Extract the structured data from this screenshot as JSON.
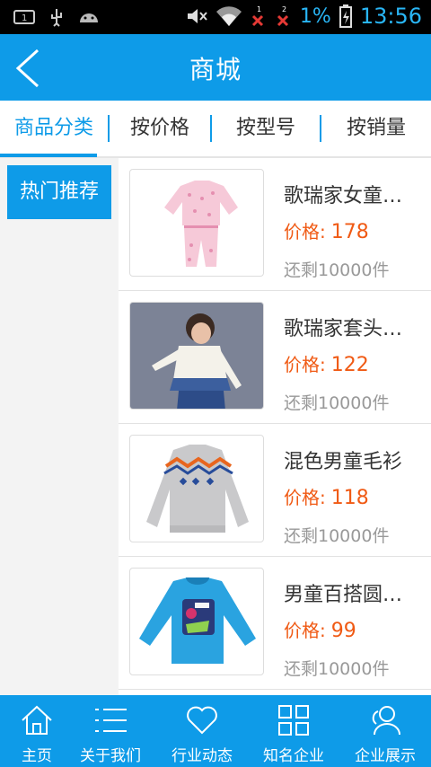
{
  "status_bar": {
    "battery_pct": "1%",
    "time": "13:56",
    "sim1": "1",
    "sim2": "2"
  },
  "header": {
    "title": "商城"
  },
  "tabs": [
    {
      "label": "商品分类",
      "active": true
    },
    {
      "label": "按价格",
      "active": false
    },
    {
      "label": "按型号",
      "active": false
    },
    {
      "label": "按销量",
      "active": false
    }
  ],
  "category": {
    "selected": "热门推荐"
  },
  "products": [
    {
      "name": "歌瑞家女童…",
      "price_label": "价格:",
      "price": "178",
      "stock": "还剩10000件",
      "image": "pink-pajama-set"
    },
    {
      "name": "歌瑞家套头…",
      "price_label": "价格:",
      "price": "122",
      "stock": "还剩10000件",
      "image": "girl-white-sweater-photo"
    },
    {
      "name": "混色男童毛衫",
      "price_label": "价格:",
      "price": "118",
      "stock": "还剩10000件",
      "image": "grey-pattern-sweater"
    },
    {
      "name": "男童百搭圆…",
      "price_label": "价格:",
      "price": "99",
      "stock": "还剩10000件",
      "image": "blue-graphic-tshirt"
    }
  ],
  "bottom_nav": [
    {
      "label": "主页",
      "icon": "home-icon"
    },
    {
      "label": "关于我们",
      "icon": "list-icon"
    },
    {
      "label": "行业动态",
      "icon": "heart-icon"
    },
    {
      "label": "知名企业",
      "icon": "grid-icon"
    },
    {
      "label": "企业展示",
      "icon": "users-icon"
    }
  ],
  "colors": {
    "primary": "#0e9be8",
    "price": "#f05a14",
    "muted": "#999999"
  }
}
